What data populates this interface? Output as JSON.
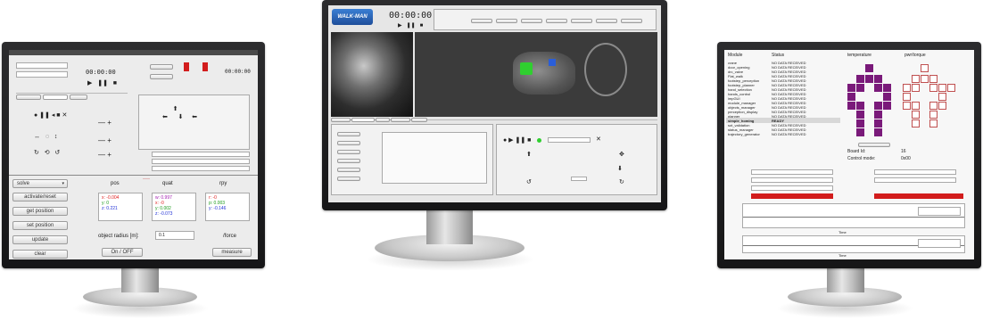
{
  "left_monitor": {
    "solver_select": "solve",
    "buttons": [
      "activate/reset",
      "get position",
      "set position",
      "update",
      "clear"
    ],
    "col_headers": [
      "pos",
      "quat",
      "rpy"
    ],
    "pos": {
      "x": "x: -0.004",
      "y": "y: 0",
      "z": "z: 0.221"
    },
    "quat": {
      "w": "w: 0.997",
      "x": "x: -0",
      "y": "y: 0.002",
      "z": "z: -0.073"
    },
    "rpy": {
      "r": "r: -0",
      "p": "p: 0.003",
      "y": "y: -0.146"
    },
    "radius_label": "object radius [m]:",
    "radius_value": "0.1",
    "toggle_label": "On / OFF",
    "force_label": "/force",
    "measure_label": "measure",
    "timer_top": "00:00:00",
    "timer_right": "00:00:00"
  },
  "center_monitor": {
    "logo": "WALK-MAN",
    "timer": "00:00:00"
  },
  "right_monitor": {
    "headers": {
      "module": "Module",
      "status": "Status",
      "temperature": "temperature",
      "torque": "pwr/torque"
    },
    "modules": [
      {
        "name": "crane",
        "status": "NO DATA RECEIVED"
      },
      {
        "name": "door_opening",
        "status": "NO DATA RECEIVED"
      },
      {
        "name": "drc_valve",
        "status": "NO DATA RECEIVED"
      },
      {
        "name": "Flat_walk",
        "status": "NO DATA RECEIVED"
      },
      {
        "name": "footstep_perception",
        "status": "NO DATA RECEIVED"
      },
      {
        "name": "footstep_planner",
        "status": "NO DATA RECEIVED"
      },
      {
        "name": "hand_selection",
        "status": "NO DATA RECEIVED"
      },
      {
        "name": "hands_control",
        "status": "NO DATA RECEIVED"
      },
      {
        "name": "impGUI",
        "status": "NO DATA RECEIVED"
      },
      {
        "name": "module_manager",
        "status": "NO DATA RECEIVED"
      },
      {
        "name": "objects_manager",
        "status": "NO DATA RECEIVED"
      },
      {
        "name": "perception_display",
        "status": "NO DATA RECEIVED"
      },
      {
        "name": "planner",
        "status": "NO DATA RECEIVED"
      },
      {
        "name": "simple_homing",
        "status": "READY"
      },
      {
        "name": "sot_validation",
        "status": "NO DATA RECEIVED"
      },
      {
        "name": "status_manager",
        "status": "NO DATA RECEIVED"
      },
      {
        "name": "trajectory_generator",
        "status": "NO DATA RECEIVED"
      }
    ],
    "board_id_label": "Board Id:",
    "board_id_value": "16",
    "control_mode_label": "Control mode:",
    "control_mode_value": "0x00",
    "time_label": "Time"
  }
}
